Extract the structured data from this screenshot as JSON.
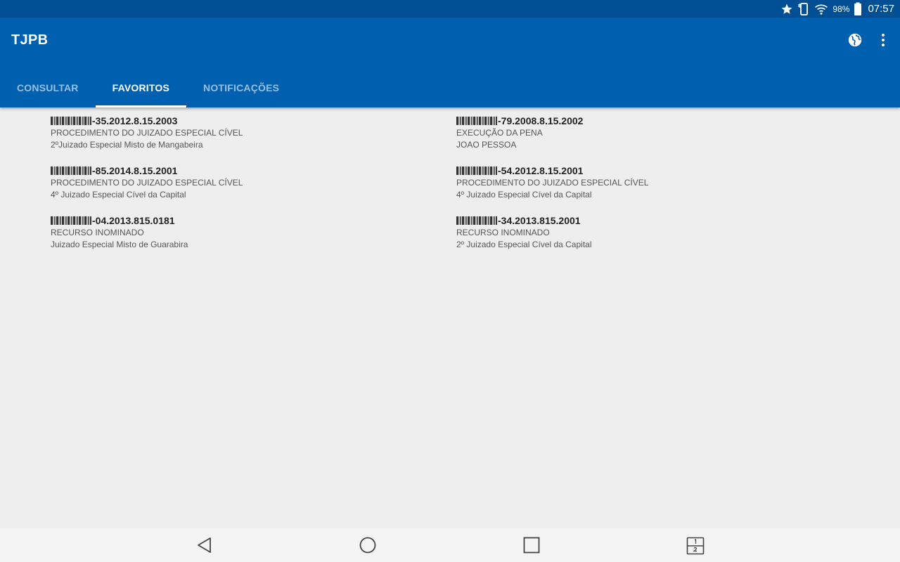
{
  "status_bar": {
    "battery_percent": "98%",
    "time": "07:57",
    "icons": [
      "star-icon",
      "phone-vibrate-icon",
      "wifi-icon",
      "battery-icon"
    ]
  },
  "app_bar": {
    "title": "TJPB",
    "actions": [
      "globe-icon",
      "more-vert-icon"
    ]
  },
  "tabs": [
    {
      "label": "CONSULTAR",
      "active": false
    },
    {
      "label": "FAVORITOS",
      "active": true
    },
    {
      "label": "NOTIFICAÇÕES",
      "active": false
    }
  ],
  "favorites": [
    {
      "number": "-35.2012.8.15.2003",
      "class": "PROCEDIMENTO DO JUIZADO ESPECIAL CÍVEL",
      "court": "2ºJuizado Especial Misto de Mangabeira"
    },
    {
      "number": "-79.2008.8.15.2002",
      "class": "EXECUÇÃO DA PENA",
      "court": "JOAO PESSOA"
    },
    {
      "number": "-85.2014.8.15.2001",
      "class": "PROCEDIMENTO DO JUIZADO ESPECIAL CÍVEL",
      "court": "4º Juizado Especial Cível da Capital"
    },
    {
      "number": "-54.2012.8.15.2001",
      "class": "PROCEDIMENTO DO JUIZADO ESPECIAL CÍVEL",
      "court": "4º Juizado Especial Cível da Capital"
    },
    {
      "number": "-04.2013.815.0181",
      "class": "RECURSO INOMINADO",
      "court": "Juizado Especial Misto de Guarabira"
    },
    {
      "number": "-34.2013.815.2001",
      "class": "RECURSO INOMINADO",
      "court": "2º Juizado Especial Cível da Capital"
    }
  ],
  "nav_bar": {
    "buttons": [
      "back-icon",
      "home-icon",
      "recents-icon",
      "dual-window-icon"
    ]
  },
  "colors": {
    "status_bar": "#004f94",
    "app_bar": "#0060b0",
    "background": "#eeeeee"
  }
}
